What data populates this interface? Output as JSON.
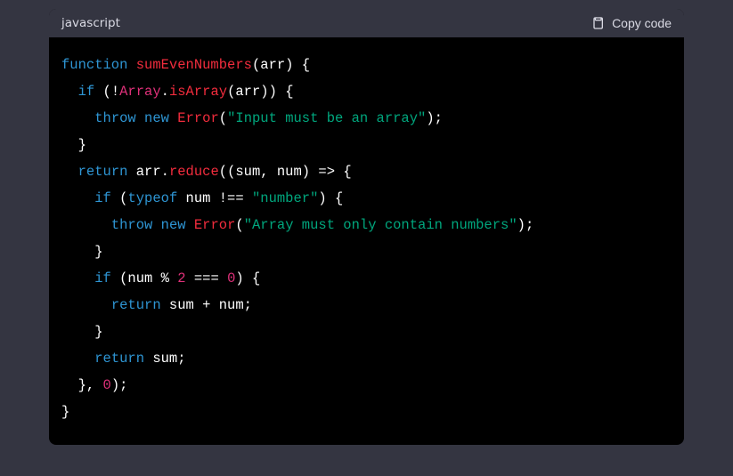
{
  "codeblock": {
    "language_label": "javascript",
    "copy_label": "Copy code",
    "tokens": [
      [
        [
          "function ",
          "keyword"
        ],
        [
          "sumEvenNumbers",
          "funcname"
        ],
        [
          "(",
          "params"
        ],
        [
          "arr",
          "default"
        ],
        [
          ") {",
          "params"
        ]
      ],
      [
        [
          "  ",
          "default"
        ],
        [
          "if",
          "keyword"
        ],
        [
          " (!",
          "default"
        ],
        [
          "Array",
          "variable"
        ],
        [
          ".",
          "default"
        ],
        [
          "isArray",
          "title"
        ],
        [
          "(arr)) {",
          "default"
        ]
      ],
      [
        [
          "    ",
          "default"
        ],
        [
          "throw",
          "keyword"
        ],
        [
          " ",
          "default"
        ],
        [
          "new",
          "keyword"
        ],
        [
          " ",
          "default"
        ],
        [
          "Error",
          "classname"
        ],
        [
          "(",
          "default"
        ],
        [
          "\"Input must be an array\"",
          "string"
        ],
        [
          ");",
          "default"
        ]
      ],
      [
        [
          "  }",
          "default"
        ]
      ],
      [
        [
          "  ",
          "default"
        ],
        [
          "return",
          "keyword"
        ],
        [
          " arr.",
          "default"
        ],
        [
          "reduce",
          "title"
        ],
        [
          "(",
          "default"
        ],
        [
          "(",
          "params"
        ],
        [
          "sum, num",
          "default"
        ],
        [
          ") =>",
          "params"
        ],
        [
          " {",
          "default"
        ]
      ],
      [
        [
          "    ",
          "default"
        ],
        [
          "if",
          "keyword"
        ],
        [
          " (",
          "default"
        ],
        [
          "typeof",
          "keyword"
        ],
        [
          " num !== ",
          "default"
        ],
        [
          "\"number\"",
          "string"
        ],
        [
          ") {",
          "default"
        ]
      ],
      [
        [
          "      ",
          "default"
        ],
        [
          "throw",
          "keyword"
        ],
        [
          " ",
          "default"
        ],
        [
          "new",
          "keyword"
        ],
        [
          " ",
          "default"
        ],
        [
          "Error",
          "classname"
        ],
        [
          "(",
          "default"
        ],
        [
          "\"Array must only contain numbers\"",
          "string"
        ],
        [
          ");",
          "default"
        ]
      ],
      [
        [
          "    }",
          "default"
        ]
      ],
      [
        [
          "    ",
          "default"
        ],
        [
          "if",
          "keyword"
        ],
        [
          " (num % ",
          "default"
        ],
        [
          "2",
          "number"
        ],
        [
          " === ",
          "default"
        ],
        [
          "0",
          "number"
        ],
        [
          ") {",
          "default"
        ]
      ],
      [
        [
          "      ",
          "default"
        ],
        [
          "return",
          "keyword"
        ],
        [
          " sum + num;",
          "default"
        ]
      ],
      [
        [
          "    }",
          "default"
        ]
      ],
      [
        [
          "    ",
          "default"
        ],
        [
          "return",
          "keyword"
        ],
        [
          " sum;",
          "default"
        ]
      ],
      [
        [
          "  }, ",
          "default"
        ],
        [
          "0",
          "number"
        ],
        [
          ");",
          "default"
        ]
      ],
      [
        [
          "}",
          "default"
        ]
      ]
    ]
  }
}
